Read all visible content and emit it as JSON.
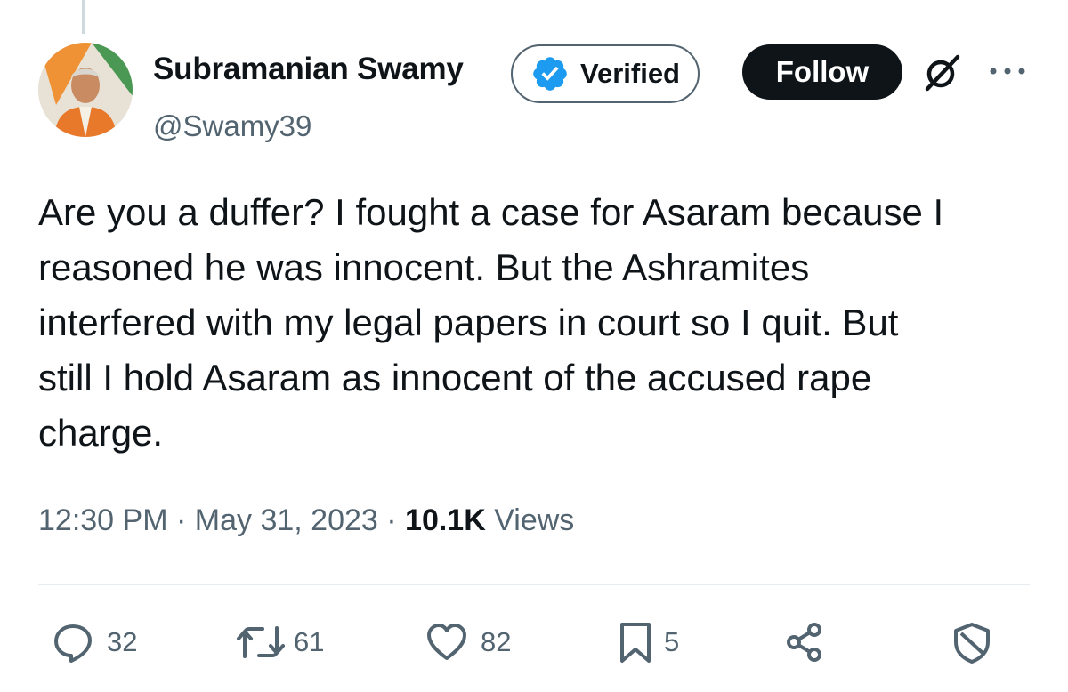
{
  "tweet": {
    "author": {
      "name": "Subramanian Swamy",
      "handle": "@Swamy39",
      "verified_label": "Verified",
      "avatar_icon": "user-avatar"
    },
    "follow_label": "Follow",
    "text": "Are you a duffer? I fought a case for Asaram because I\nreasoned he was innocent. But the Ashramites\ninterfered with my legal papers in court so I quit. But\nstill I hold Asaram as innocent of the accused rape\ncharge.",
    "time": "12:30 PM",
    "separator": "·",
    "date": "May 31, 2023",
    "views_count": "10.1K",
    "views_label": "Views",
    "actions": {
      "replies": "32",
      "reposts": "61",
      "likes": "82",
      "bookmarks": "5"
    }
  },
  "icons": {
    "verified": "verified-badge-icon",
    "grok": "grok-icon",
    "more": "more-options-icon",
    "reply": "reply-icon",
    "repost": "repost-icon",
    "like": "heart-icon",
    "bookmark": "bookmark-icon",
    "share": "share-icon",
    "block": "shield-icon"
  },
  "colors": {
    "verified_blue": "#1d9bf0",
    "text_primary": "#0f1419",
    "text_secondary": "#536471",
    "follow_bg": "#0f1419"
  }
}
